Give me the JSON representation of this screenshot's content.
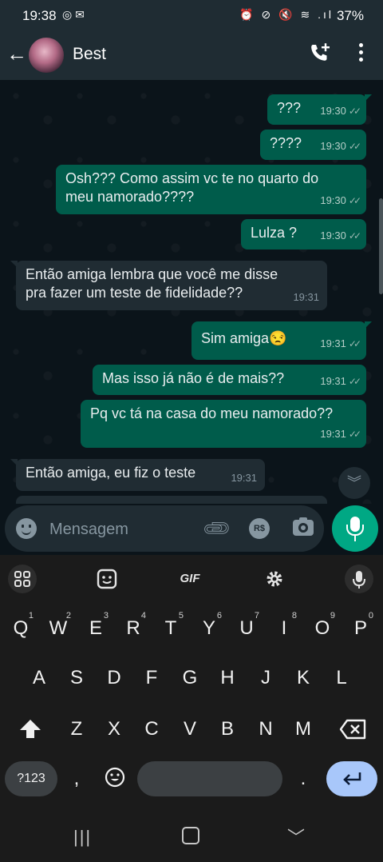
{
  "status_bar": {
    "time": "19:38",
    "battery": "37%",
    "left_icons": "◎ ✉",
    "right_icons": "⏰ ⊘ 🔇 ≋ .ıl"
  },
  "header": {
    "contact_name": "Best"
  },
  "messages": [
    {
      "dir": "out",
      "text": "???",
      "time": "19:30",
      "ticks": "✓✓"
    },
    {
      "dir": "out",
      "text": "????",
      "time": "19:30",
      "ticks": "✓✓"
    },
    {
      "dir": "out",
      "text": "Osh??? Como assim vc te no quarto do meu namorado????",
      "time": "19:30",
      "ticks": "✓✓"
    },
    {
      "dir": "out",
      "text": "Lulza ?",
      "time": "19:30",
      "ticks": "✓✓"
    },
    {
      "dir": "in",
      "text": "Então amiga lembra que você me disse pra  fazer um teste de fidelidade??",
      "time": "19:31"
    },
    {
      "dir": "out",
      "text": "Sim amiga😒",
      "time": "19:31",
      "ticks": "✓✓"
    },
    {
      "dir": "out",
      "text": "Mas isso já não é de mais??",
      "time": "19:31",
      "ticks": "✓✓"
    },
    {
      "dir": "out",
      "text": "Pq vc tá na casa do meu namorado??",
      "time": "19:31",
      "ticks": "✓✓"
    },
    {
      "dir": "in",
      "text": "Então amiga, eu fiz o teste",
      "time": "19:31"
    }
  ],
  "composer": {
    "placeholder": "Mensagem",
    "currency_label": "R$"
  },
  "keyboard": {
    "row1": [
      "Q",
      "W",
      "E",
      "R",
      "T",
      "Y",
      "U",
      "I",
      "O",
      "P"
    ],
    "row1_hints": [
      "1",
      "2",
      "3",
      "4",
      "5",
      "6",
      "7",
      "8",
      "9",
      "0"
    ],
    "row2": [
      "A",
      "S",
      "D",
      "F",
      "G",
      "H",
      "J",
      "K",
      "L"
    ],
    "row3": [
      "Z",
      "X",
      "C",
      "V",
      "B",
      "N",
      "M"
    ],
    "symbols_label": "?123",
    "comma": ",",
    "period": ".",
    "gif_label": "GIF"
  },
  "colors": {
    "outgoing_bubble": "#005c4b",
    "incoming_bubble": "#202c33",
    "accent": "#00a884"
  }
}
